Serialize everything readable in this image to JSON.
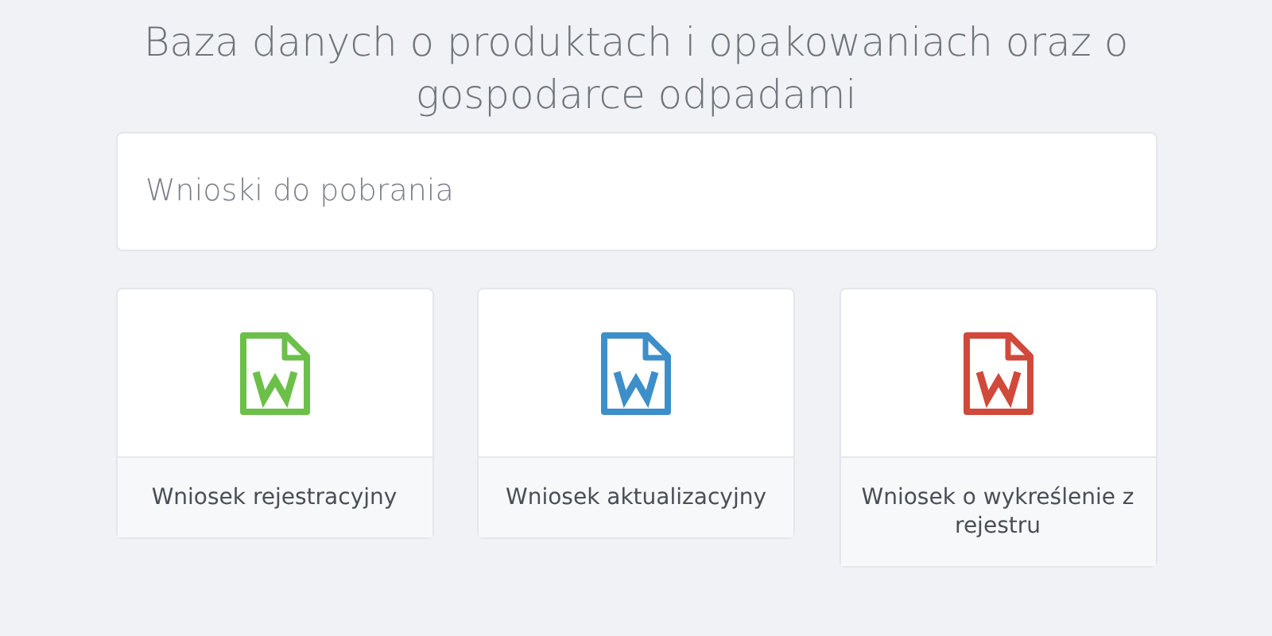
{
  "title": "Baza danych o produktach i opakowaniach oraz o gospodarce odpadami",
  "section": {
    "heading": "Wnioski do pobrania"
  },
  "documents": [
    {
      "label": "Wniosek rejestracyjny",
      "color": "#6cc04a"
    },
    {
      "label": "Wniosek aktualizacyjny",
      "color": "#3d8fc9"
    },
    {
      "label": "Wniosek o wykreślenie z rejestru",
      "color": "#d0493a"
    }
  ]
}
